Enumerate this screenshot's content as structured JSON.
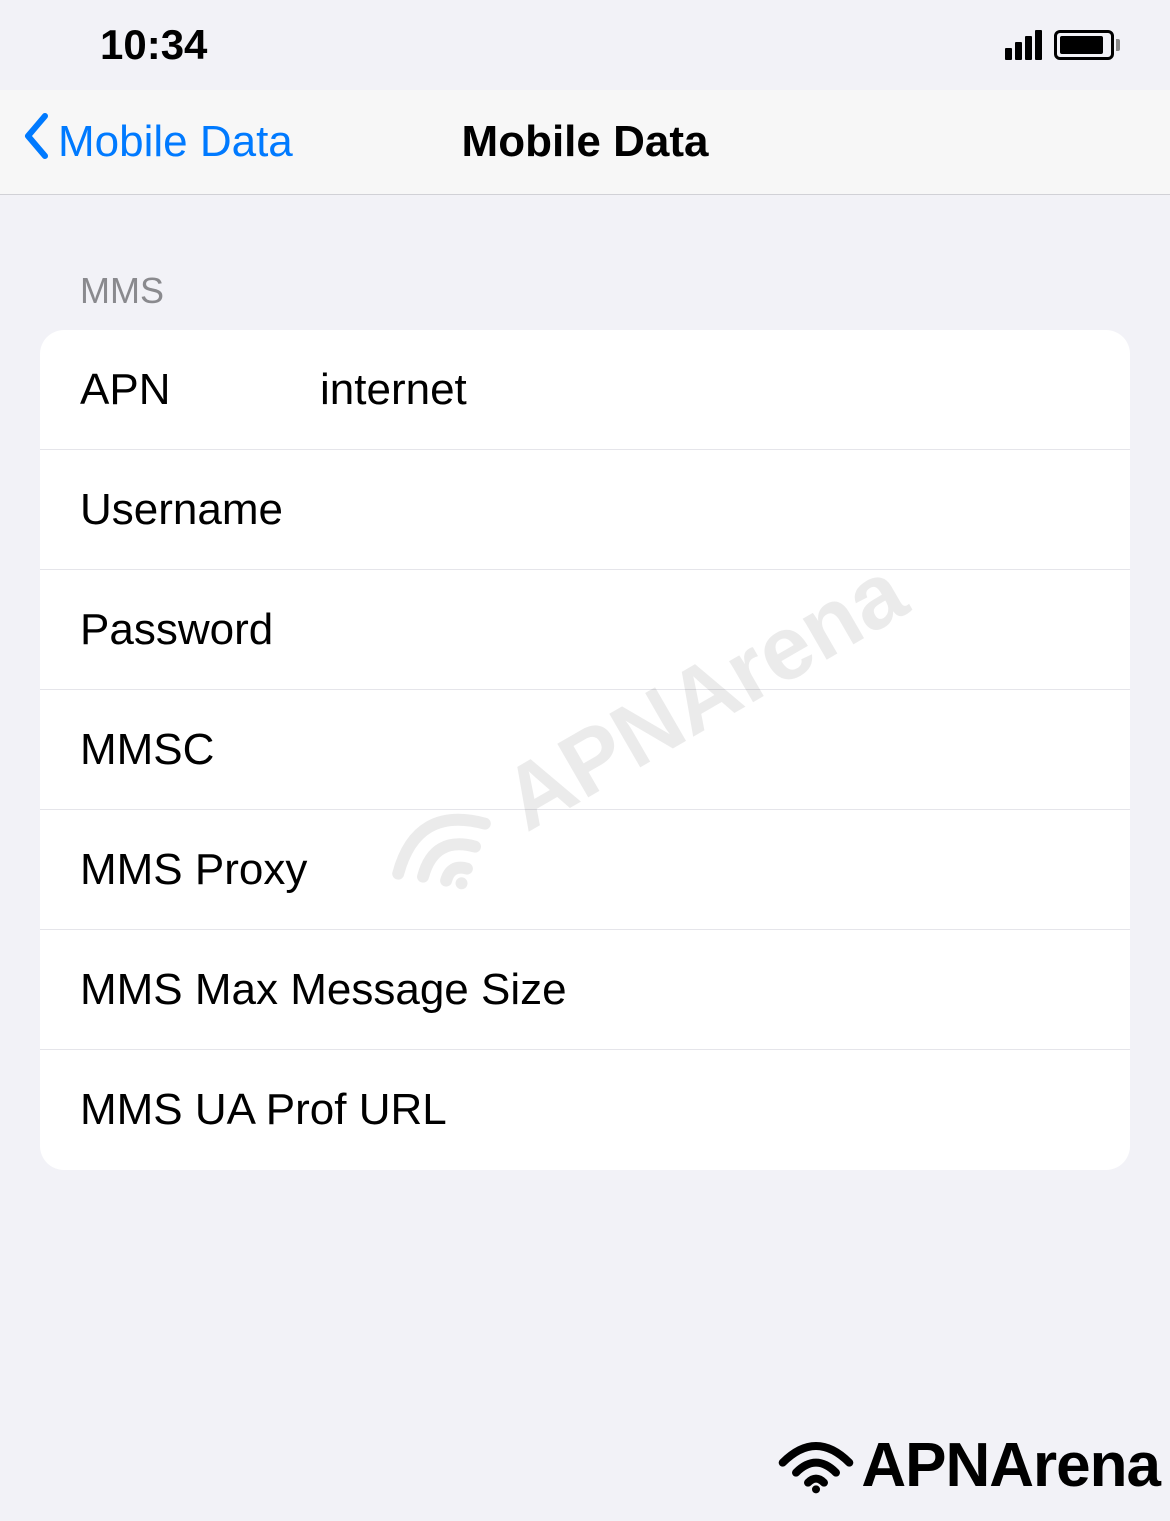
{
  "status_bar": {
    "time": "10:34"
  },
  "nav": {
    "back_label": "Mobile Data",
    "title": "Mobile Data"
  },
  "section": {
    "header": "MMS"
  },
  "fields": {
    "apn": {
      "label": "APN",
      "value": "internet"
    },
    "username": {
      "label": "Username",
      "value": ""
    },
    "password": {
      "label": "Password",
      "value": ""
    },
    "mmsc": {
      "label": "MMSC",
      "value": ""
    },
    "mms_proxy": {
      "label": "MMS Proxy",
      "value": ""
    },
    "mms_max_size": {
      "label": "MMS Max Message Size",
      "value": ""
    },
    "mms_ua_prof": {
      "label": "MMS UA Prof URL",
      "value": ""
    }
  },
  "brand": {
    "name": "APNArena"
  }
}
